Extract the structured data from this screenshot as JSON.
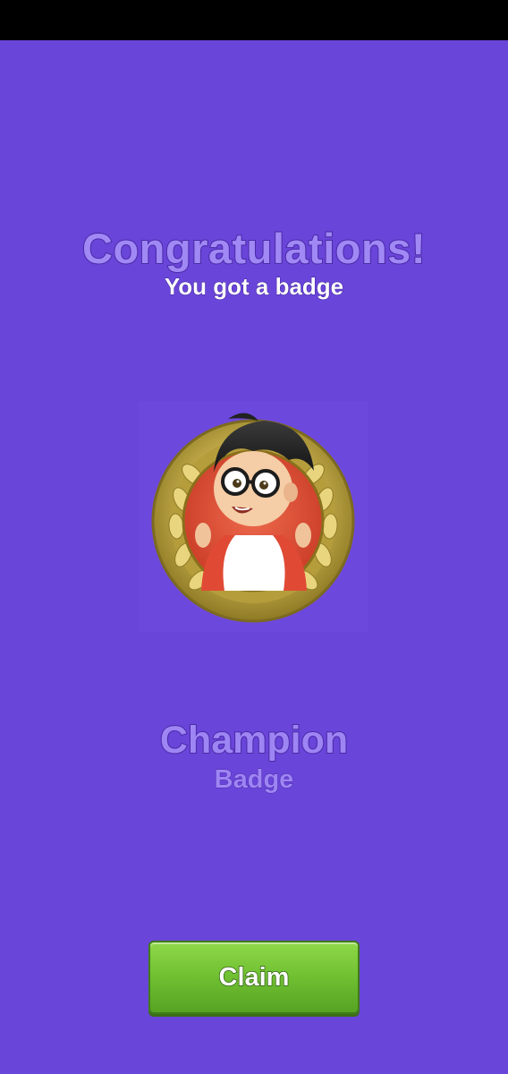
{
  "header": {
    "title": "Congratulations!",
    "subtitle": "You got a badge"
  },
  "badge": {
    "name": "Champion",
    "type": "Badge",
    "icon": "champion-medal-icon"
  },
  "actions": {
    "claim_label": "Claim"
  },
  "colors": {
    "background": "#6a45d9",
    "title_text": "#a088f5",
    "claim_button": "#72c233",
    "medal_gold": "#c8b24a",
    "medal_inner": "#e0523a"
  }
}
